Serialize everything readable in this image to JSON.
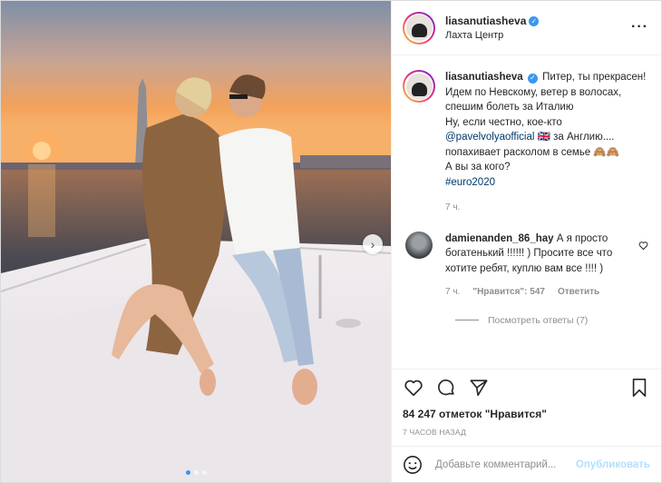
{
  "post": {
    "username": "liasanutiasheva",
    "location": "Лахта Центр",
    "caption_lines": [
      "Питер, ты прекрасен!",
      "Идем по Невскому, ветер в волосах, спешим болеть за Италию",
      "Ну, если честно, кое-кто",
      "@pavelvolyaofficial",
      "🇬🇧 за Англию....",
      "попахивает расколом в семье 🙈🙈",
      "А вы за кого?",
      "#euro2020"
    ],
    "caption_age": "7 ч.",
    "comment": {
      "username": "damienanden_86_hay",
      "text": "А я просто богатенький !!!!!! ) Просите все что хотите ребят, куплю вам все !!!! )",
      "age": "7 ч.",
      "likes": "\"Нравится\": 547",
      "reply": "Ответить",
      "view_replies": "Посмотреть ответы (7)"
    },
    "likes_text": "84 247 отметок \"Нравится\"",
    "timestamp": "7 ЧАСОВ НАЗАД",
    "comment_placeholder": "Добавьте комментарий...",
    "publish_label": "Опубликовать",
    "more_label": "···",
    "verified_mark": "✓",
    "carousel": {
      "slides": 3,
      "active": 0,
      "next_arrow": "›"
    }
  },
  "icons": [
    "more-icon",
    "verified-icon",
    "heart-icon",
    "comment-icon",
    "share-icon",
    "bookmark-icon",
    "emoji-icon",
    "chevron-right-icon"
  ],
  "colors": {
    "link": "#00376b",
    "verified": "#3897f0",
    "publish_disabled": "#b2dffc",
    "muted": "#8e8e8e"
  }
}
